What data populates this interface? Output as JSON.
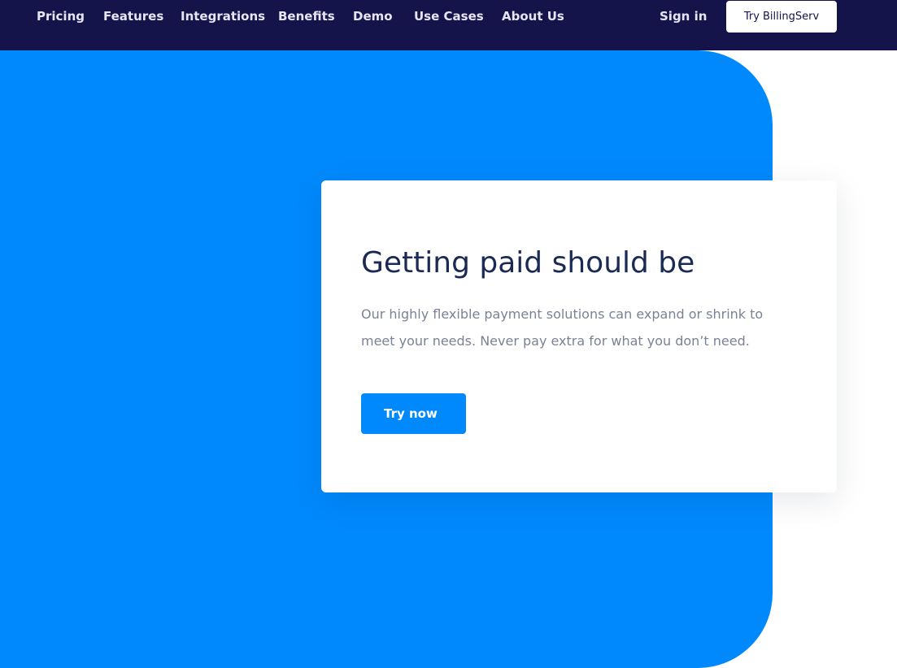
{
  "nav": {
    "links": [
      "Pricing",
      "Features",
      "Integrations",
      "Benefits",
      "Demo",
      "Use Cases",
      "About Us"
    ],
    "sign_in": "Sign in",
    "cta": "Try BillingServ"
  },
  "hero": {
    "title": "Getting paid should be",
    "description": "Our highly flexible payment solutions can expand or shrink to meet your needs. Never pay extra for what you don’t need.",
    "cta": "Try now"
  },
  "colors": {
    "nav_bg": "#14134a",
    "hero_blue": "#0089fc",
    "title": "#1b2a55",
    "body_text": "#7c8296"
  }
}
